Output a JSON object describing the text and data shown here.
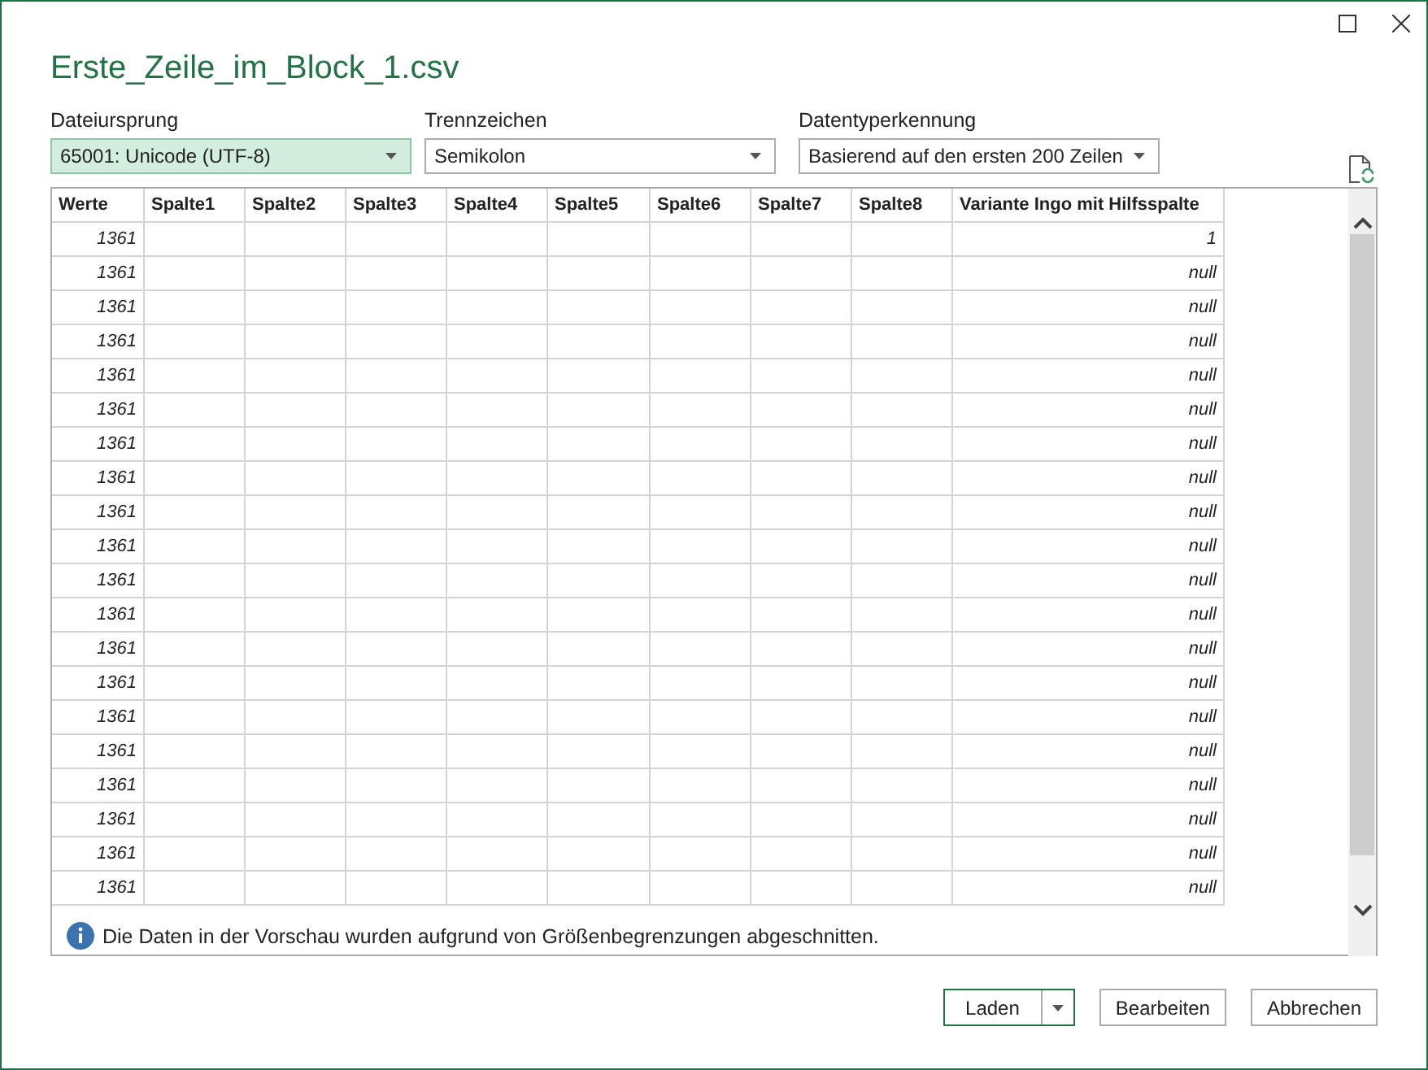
{
  "window": {
    "title": "Erste_Zeile_im_Block_1.csv"
  },
  "options": [
    {
      "label": "Dateiursprung",
      "value": "65001: Unicode (UTF-8)",
      "selected": true
    },
    {
      "label": "Trennzeichen",
      "value": "Semikolon",
      "selected": false
    },
    {
      "label": "Datentyperkennung",
      "value": "Basierend auf den ersten 200 Zeilen",
      "selected": false
    }
  ],
  "table": {
    "columns": [
      "Werte",
      "Spalte1",
      "Spalte2",
      "Spalte3",
      "Spalte4",
      "Spalte5",
      "Spalte6",
      "Spalte7",
      "Spalte8",
      "Variante Ingo mit Hilfsspalte"
    ],
    "rows": [
      {
        "werte": "1361",
        "variante": "1"
      },
      {
        "werte": "1361",
        "variante": "null"
      },
      {
        "werte": "1361",
        "variante": "null"
      },
      {
        "werte": "1361",
        "variante": "null"
      },
      {
        "werte": "1361",
        "variante": "null"
      },
      {
        "werte": "1361",
        "variante": "null"
      },
      {
        "werte": "1361",
        "variante": "null"
      },
      {
        "werte": "1361",
        "variante": "null"
      },
      {
        "werte": "1361",
        "variante": "null"
      },
      {
        "werte": "1361",
        "variante": "null"
      },
      {
        "werte": "1361",
        "variante": "null"
      },
      {
        "werte": "1361",
        "variante": "null"
      },
      {
        "werte": "1361",
        "variante": "null"
      },
      {
        "werte": "1361",
        "variante": "null"
      },
      {
        "werte": "1361",
        "variante": "null"
      },
      {
        "werte": "1361",
        "variante": "null"
      },
      {
        "werte": "1361",
        "variante": "null"
      },
      {
        "werte": "1361",
        "variante": "null"
      },
      {
        "werte": "1361",
        "variante": "null"
      },
      {
        "werte": "1361",
        "variante": "null"
      }
    ]
  },
  "info": "Die Daten in der Vorschau wurden aufgrund von Größenbegrenzungen abgeschnitten.",
  "buttons": [
    {
      "label": "Laden",
      "kind": "split"
    },
    {
      "label": "Bearbeiten",
      "kind": "plain"
    },
    {
      "label": "Abbrechen",
      "kind": "plain"
    }
  ]
}
